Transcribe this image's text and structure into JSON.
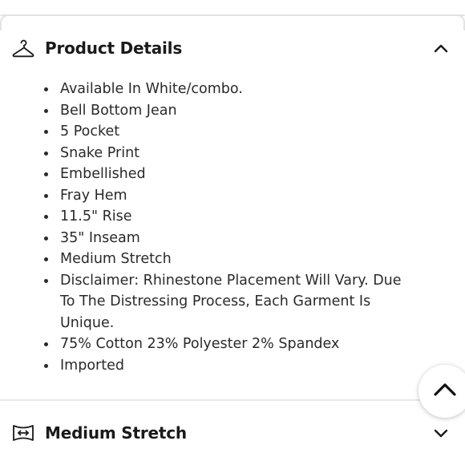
{
  "product_details": {
    "title": "Product Details",
    "icon": "hanger-icon",
    "expanded": true,
    "items": [
      {
        "text": "Available In White/combo."
      },
      {
        "text": "Bell Bottom Jean"
      },
      {
        "text": "5 Pocket"
      },
      {
        "text": "Snake Print"
      },
      {
        "text": "Embellished"
      },
      {
        "text": "Fray Hem"
      },
      {
        "text": "11.5\" Rise"
      },
      {
        "text": "35\" Inseam"
      },
      {
        "text": "Medium Stretch"
      },
      {
        "text": "Disclaimer: Rhinestone Placement Will Vary. Due To The Distressing Process, Each Garment Is Unique."
      },
      {
        "text": "75% Cotton 23% Polyester 2% Spandex"
      },
      {
        "text": "Imported"
      }
    ]
  },
  "stretch_section": {
    "title": "Medium Stretch",
    "icon": "stretch-icon",
    "expanded": false
  },
  "scroll_top": {
    "icon": "chevron-up-icon"
  }
}
